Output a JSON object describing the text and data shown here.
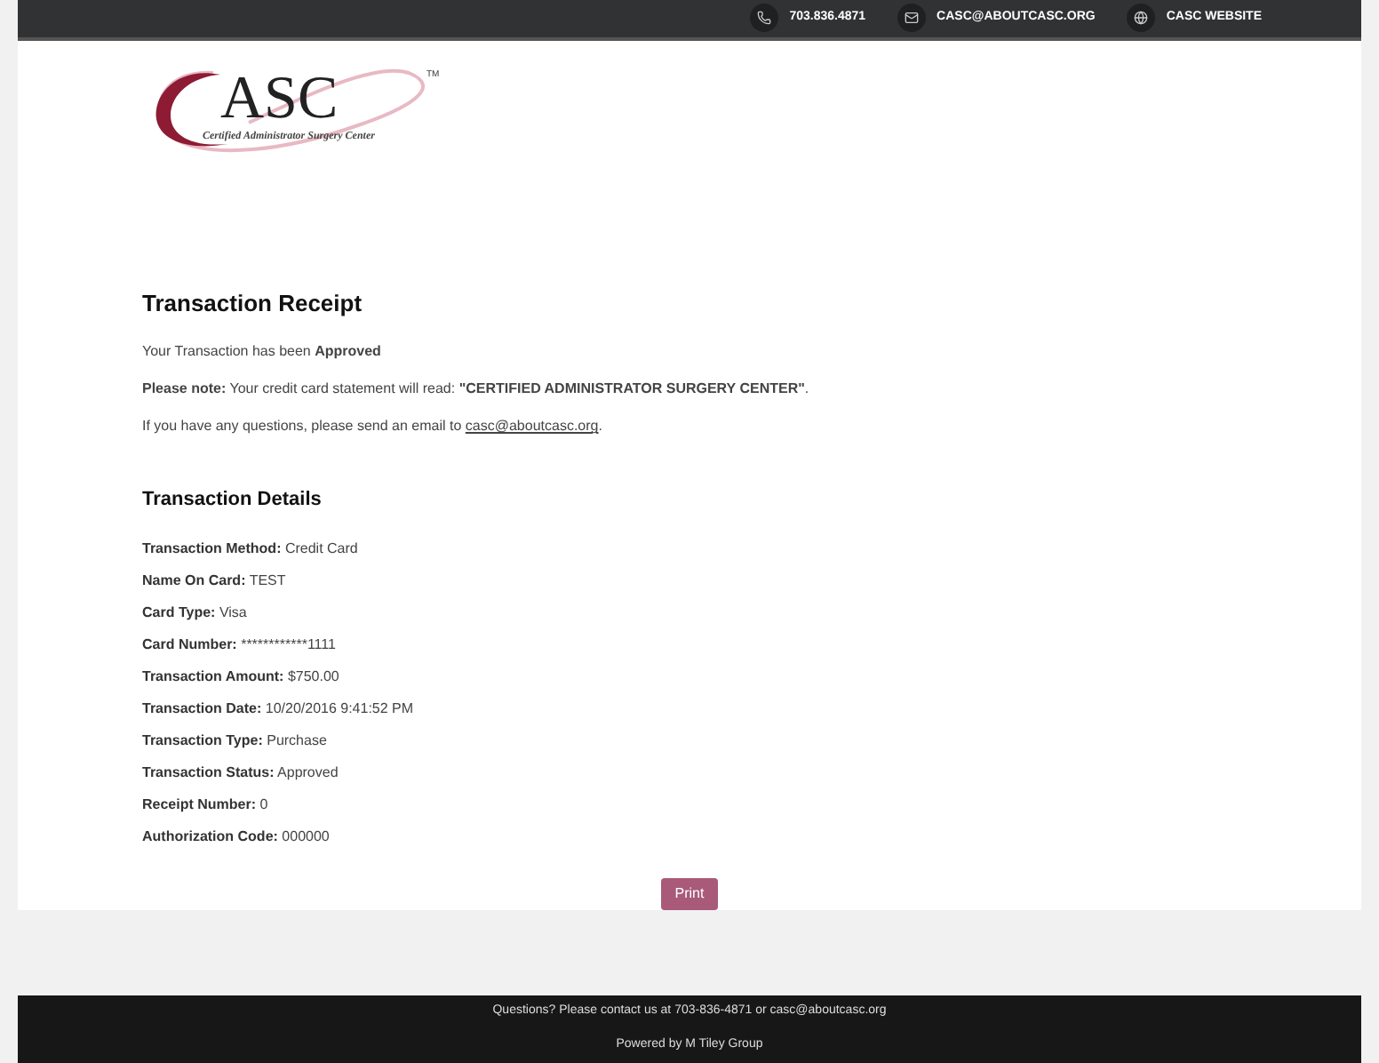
{
  "top_bar": {
    "links": [
      {
        "kind": "phone",
        "label": "703.836.4871"
      },
      {
        "kind": "mail",
        "label": "CASC@ABOUTCASC.ORG"
      },
      {
        "kind": "web",
        "label": "CASC WEBSITE"
      }
    ]
  },
  "logo": {
    "wordmark": "ASC",
    "trademark": "TM",
    "tagline": "Certified Administrator Surgery Center"
  },
  "receipt": {
    "title": "Transaction Receipt",
    "status_line": "Your Transaction has been **Approved**",
    "note": "**Please note:** Your credit card statement will read: **\"CERTIFIED ADMINISTRATOR SURGERY CENTER\"**.",
    "contact_prefix": "If you have any questions, please send an email to ",
    "contact_link": "casc@aboutcasc.org",
    "contact_suffix": "."
  },
  "details": {
    "title": "Transaction Details",
    "rows": [
      {
        "label": "Transaction Method:",
        "value": "Credit Card"
      },
      {
        "label": "Name On Card:",
        "value": "TEST"
      },
      {
        "label": "Card Type:",
        "value": "Visa"
      },
      {
        "label": "Card Number:",
        "value": "************1111"
      },
      {
        "label": "Transaction Amount:",
        "value": "$750.00"
      },
      {
        "label": "Transaction Date:",
        "value": "10/20/2016 9:41:52 PM"
      },
      {
        "label": "Transaction Type:",
        "value": "Purchase"
      },
      {
        "label": "Transaction Status:",
        "value": "Approved"
      },
      {
        "label": "Receipt Number:",
        "value": "0"
      },
      {
        "label": "Authorization Code:",
        "value": "000000"
      }
    ]
  },
  "print_button": "Print",
  "footer": {
    "lines": [
      "Questions? Please contact us at 703-836-4871 or casc@aboutcasc.org",
      "Powered by M Tiley Group"
    ]
  }
}
